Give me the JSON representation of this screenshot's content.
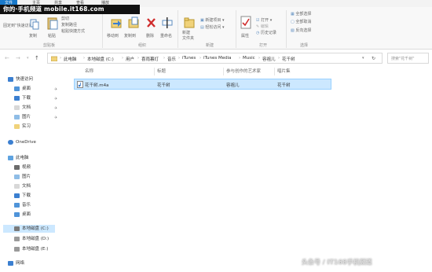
{
  "watermark_text": "你的·手机频道 mobile.it168.com",
  "tabs": {
    "file": "文件",
    "t1": "主页",
    "t2": "共享",
    "t3": "查看",
    "t4": "播放"
  },
  "ribbon": {
    "pin_label": "固定到“快速访问”",
    "copy": "复制",
    "paste": "粘贴",
    "cut": "剪切",
    "copy_path": "复制路径",
    "paste_shortcut": "粘贴快捷方式",
    "move_to": "移动到",
    "copy_to": "复制到",
    "delete": "删除",
    "rename": "重命名",
    "new_folder": "新建\n文件夹",
    "new_item": "新建项目",
    "easy_access": "轻松访问",
    "properties": "属性",
    "open": "打开",
    "edit": "编辑",
    "history": "历史记录",
    "select_all": "全部选择",
    "select_none": "全部取消",
    "invert_selection": "反向选择",
    "group_clipboard": "剪贴板",
    "group_organize": "组织",
    "group_new": "新建",
    "group_open": "打开",
    "group_select": "选择"
  },
  "address": {
    "crumbs": [
      "此电脑",
      "本地磁盘 (C:)",
      "用户",
      "喜雨暮灯",
      "音乐",
      "iTunes",
      "iTunes Media",
      "Music",
      "容祖儿",
      "花千树"
    ],
    "search_placeholder": "搜索\"花千树\""
  },
  "sidebar": {
    "quick_access": "快速访问",
    "pinned": [
      "桌面",
      "下载",
      "文档",
      "图片",
      "实习"
    ],
    "onedrive": "OneDrive",
    "this_pc": "此电脑",
    "pc_items": [
      "视频",
      "图片",
      "文档",
      "下载",
      "音乐",
      "桌面"
    ],
    "drives": [
      "本地磁盘 (C:)",
      "本地磁盘 (D:)",
      "本地磁盘 (E:)"
    ],
    "network": "网络"
  },
  "columns": {
    "name": "名称",
    "title": "标题",
    "contributing_artists": "参与创作的艺术家",
    "album": "唱片集"
  },
  "files": [
    {
      "name": "花千树.m4a",
      "title": "花千树",
      "artist": "容祖儿",
      "album": "花千树"
    }
  ],
  "footer_watermark": "头条号 / IT168手机频道",
  "colors": {
    "accent": "#1979ca",
    "selection": "#cce8ff",
    "selection_border": "#99d1ff"
  }
}
